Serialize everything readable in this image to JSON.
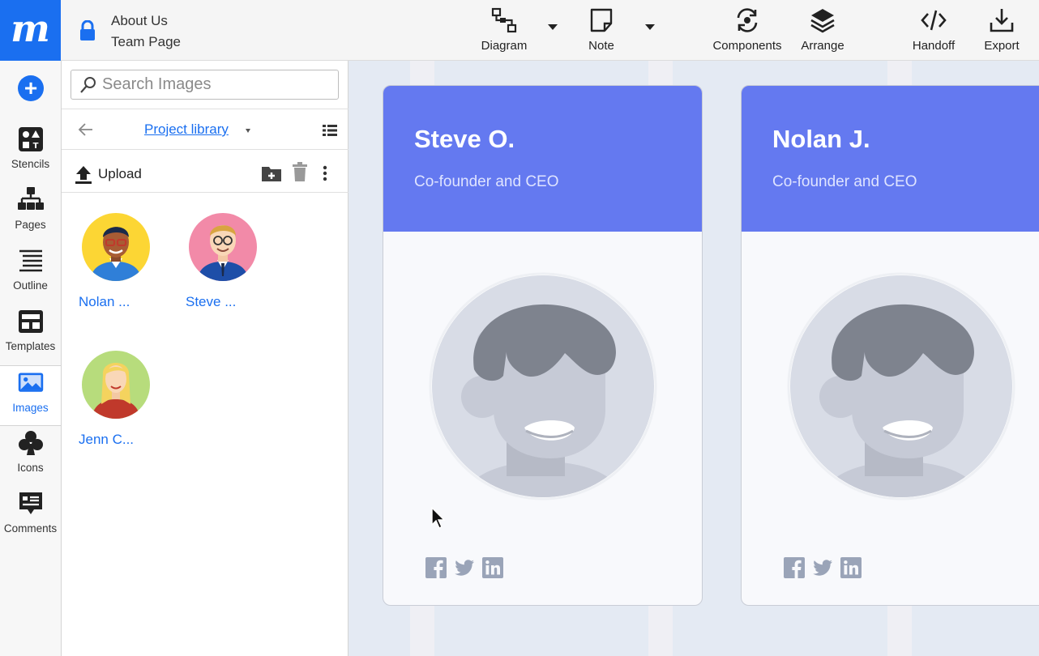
{
  "document": {
    "title_line1": "About Us",
    "title_line2": "Team Page"
  },
  "toolbar": [
    {
      "label": "Diagram",
      "icon": "diagram-icon"
    },
    {
      "label": "Note",
      "icon": "note-icon"
    },
    {
      "label": "Components",
      "icon": "components-icon"
    },
    {
      "label": "Arrange",
      "icon": "arrange-icon"
    },
    {
      "label": "Handoff",
      "icon": "handoff-icon"
    },
    {
      "label": "Export",
      "icon": "export-icon"
    }
  ],
  "rail": [
    {
      "label": "Stencils",
      "icon": "stencils-icon"
    },
    {
      "label": "Pages",
      "icon": "pages-icon"
    },
    {
      "label": "Outline",
      "icon": "outline-icon"
    },
    {
      "label": "Templates",
      "icon": "templates-icon"
    },
    {
      "label": "Images",
      "icon": "images-icon",
      "active": true
    },
    {
      "label": "Icons",
      "icon": "club-icon"
    },
    {
      "label": "Comments",
      "icon": "comments-icon"
    }
  ],
  "panel": {
    "search_placeholder": "Search Images",
    "library_label": "Project library",
    "upload_label": "Upload",
    "images": [
      {
        "name": "Nolan ..."
      },
      {
        "name": "Steve ..."
      },
      {
        "name": "Jenn C..."
      }
    ]
  },
  "cards": [
    {
      "name": "Steve O.",
      "role": "Co-founder and CEO"
    },
    {
      "name": "Nolan J.",
      "role": "Co-founder and CEO"
    }
  ],
  "colors": {
    "brand": "#1a6ff0",
    "card_header": "#6479f0",
    "avatar_placeholder": "#cfd3dd",
    "social_icons": "#9aa4b8"
  }
}
